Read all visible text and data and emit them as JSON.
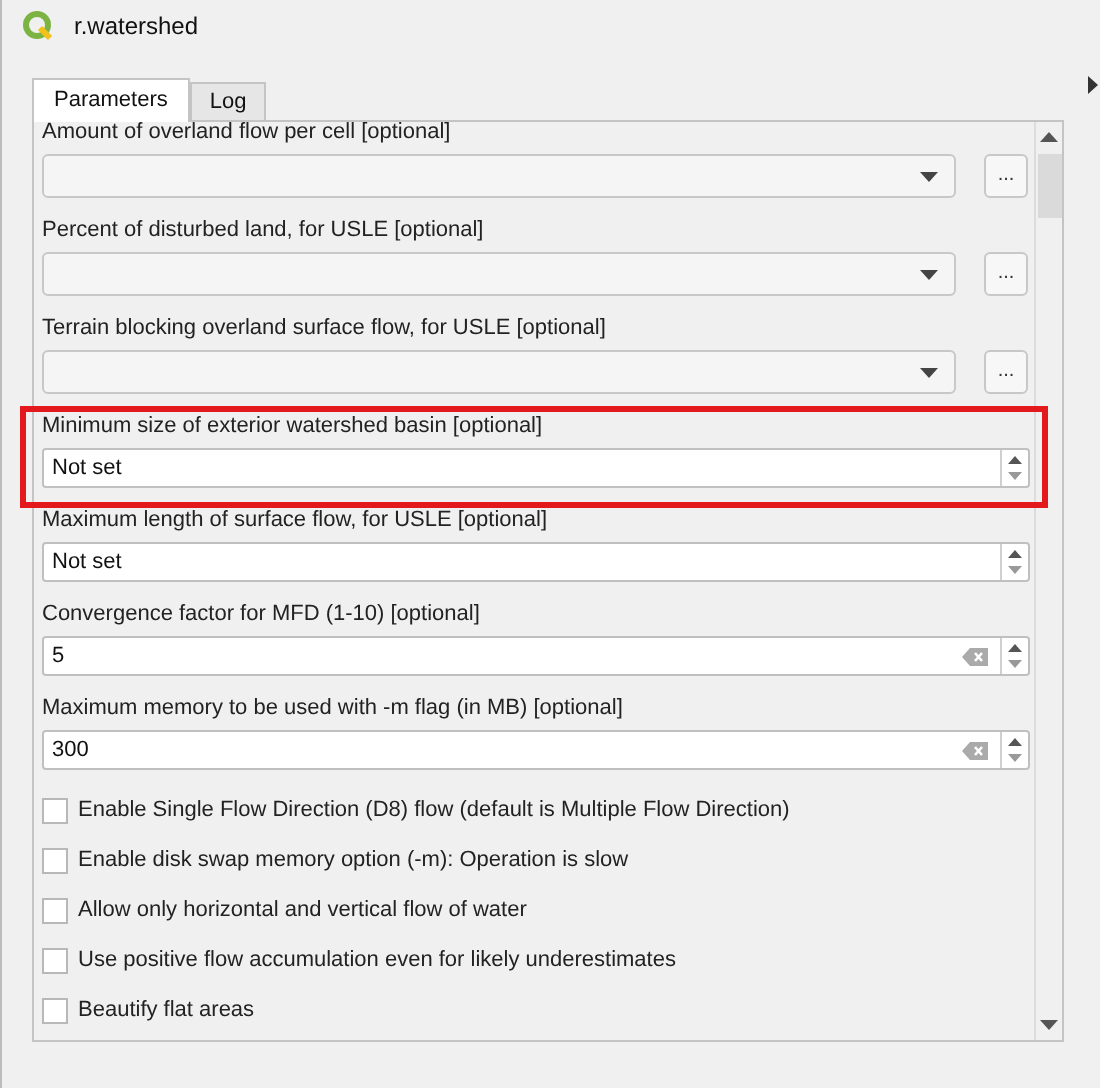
{
  "window": {
    "title": "r.watershed"
  },
  "tabs": [
    {
      "label": "Parameters",
      "selected": true
    },
    {
      "label": "Log",
      "selected": false
    }
  ],
  "parameters": [
    {
      "kind": "combo",
      "label": "Amount of overland flow per cell [optional]",
      "button": "...",
      "highlighted": false
    },
    {
      "kind": "combo",
      "label": "Percent of disturbed land, for USLE [optional]",
      "button": "...",
      "highlighted": false
    },
    {
      "kind": "combo",
      "label": "Terrain blocking overland surface flow, for USLE [optional]",
      "button": "...",
      "highlighted": false
    },
    {
      "kind": "spin",
      "label": "Minimum size of exterior watershed basin [optional]",
      "value": "Not set",
      "clearable": false,
      "highlighted": true
    },
    {
      "kind": "spin",
      "label": "Maximum length of surface flow, for USLE [optional]",
      "value": "Not set",
      "clearable": false,
      "highlighted": false
    },
    {
      "kind": "spin",
      "label": "Convergence factor for MFD (1-10) [optional]",
      "value": "5",
      "clearable": true,
      "highlighted": false
    },
    {
      "kind": "spin",
      "label": "Maximum memory to be used with -m flag (in MB) [optional]",
      "value": "300",
      "clearable": true,
      "highlighted": false
    }
  ],
  "checkboxes": [
    {
      "label": "Enable Single Flow Direction (D8) flow (default is Multiple Flow Direction)",
      "checked": false
    },
    {
      "label": "Enable disk swap memory option (-m): Operation is slow",
      "checked": false
    },
    {
      "label": "Allow only horizontal and vertical flow of water",
      "checked": false
    },
    {
      "label": "Use positive flow accumulation even for likely underestimates",
      "checked": false
    },
    {
      "label": "Beautify flat areas",
      "checked": false
    }
  ]
}
